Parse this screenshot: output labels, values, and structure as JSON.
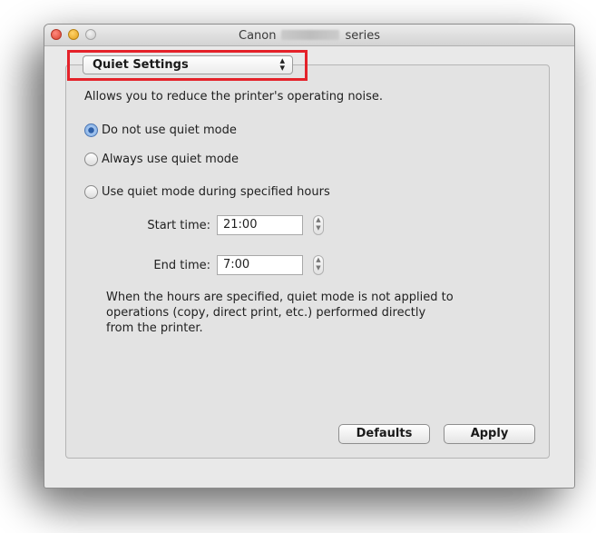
{
  "window": {
    "title_prefix": "Canon",
    "title_suffix": "series"
  },
  "popup": {
    "selected": "Quiet Settings",
    "arrows": "⬍"
  },
  "description": "Allows you to reduce the printer's operating noise.",
  "options": [
    {
      "label": "Do not use quiet mode",
      "selected": true
    },
    {
      "label": "Always use quiet mode",
      "selected": false
    },
    {
      "label": "Use quiet mode during specified hours",
      "selected": false
    }
  ],
  "start_time": {
    "label": "Start time:",
    "value": "21:00"
  },
  "end_time": {
    "label": "End time:",
    "value": "7:00"
  },
  "note": "When the hours are specified, quiet mode is not applied to\noperations (copy, direct print, etc.) performed directly\nfrom the printer.",
  "buttons": {
    "defaults": "Defaults",
    "apply": "Apply"
  },
  "colors": {
    "highlight": "#e4222a",
    "radio_selected": "#2d5fa8"
  }
}
